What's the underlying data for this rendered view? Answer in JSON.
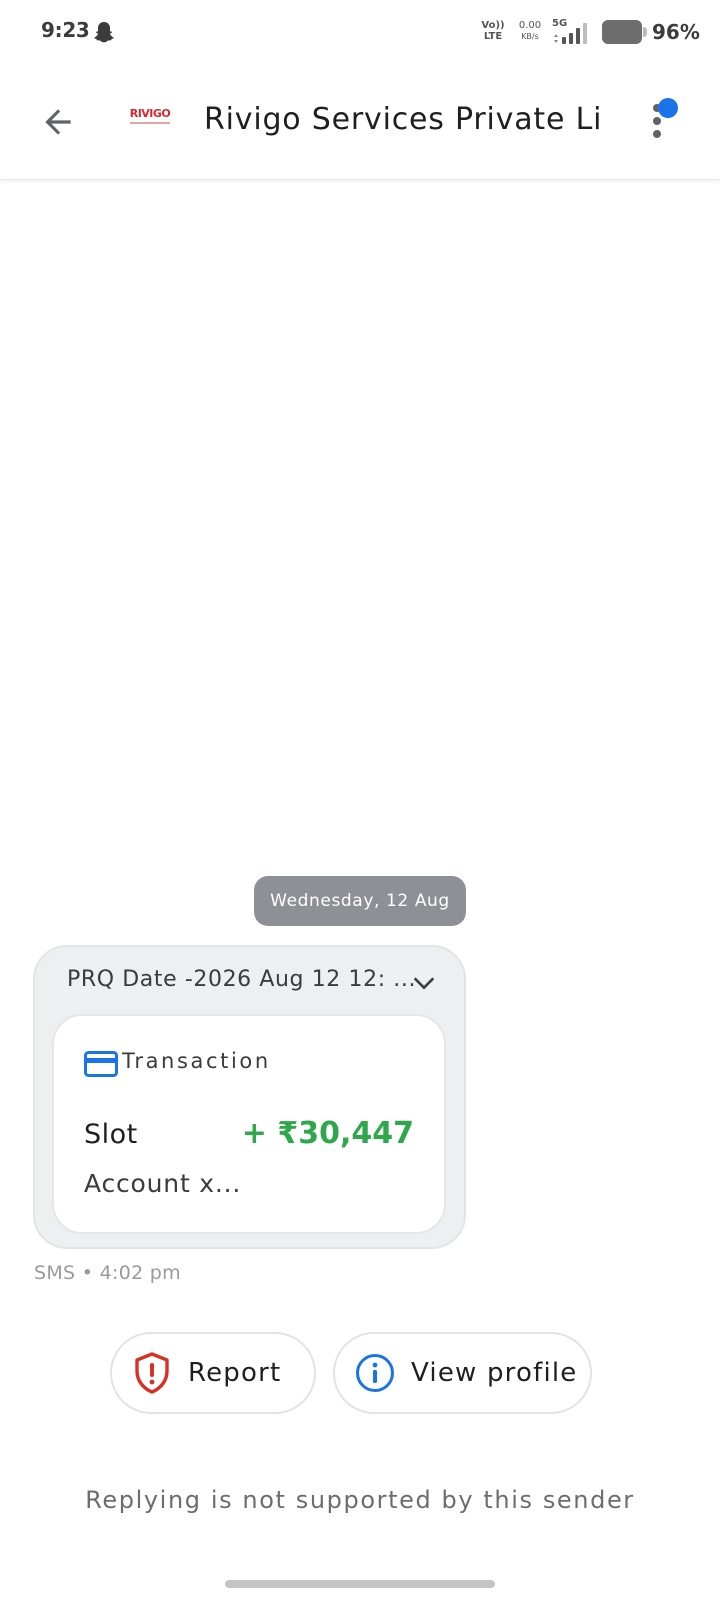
{
  "status_bar": {
    "time": "9:23",
    "volte_top": "Vo))",
    "volte_bottom": "LTE",
    "net_speed_value": "0.00",
    "net_speed_unit": "KB/s",
    "network_gen": "5G",
    "battery_percent": "96%",
    "icons": [
      "snapchat-ghost-icon",
      "signal-icon",
      "battery-icon"
    ]
  },
  "app_bar": {
    "sender_name": "Rivigo Services Private Li...",
    "logo_text": "RIVIGO",
    "back_icon": "arrow-left-icon",
    "more_icon": "more-vert-icon",
    "notification_color": "#1a73e8"
  },
  "conversation": {
    "date_chip": "Wednesday, 12 Aug",
    "message": {
      "preview": "PRQ Date -2026 Aug 12 12: ...",
      "card_title": "Transaction",
      "txn_label": "Slot",
      "amount": "+ ₹30,447",
      "account": "Account x...",
      "meta": "SMS • 4:02 pm",
      "amount_color": "#2ea84a"
    }
  },
  "actions": {
    "report_label": "Report",
    "view_profile_label": "View profile",
    "report_icon_color": "#d93025",
    "info_icon_color": "#1a73e8"
  },
  "footer": {
    "reply_note": "Replying is not supported by this sender"
  }
}
